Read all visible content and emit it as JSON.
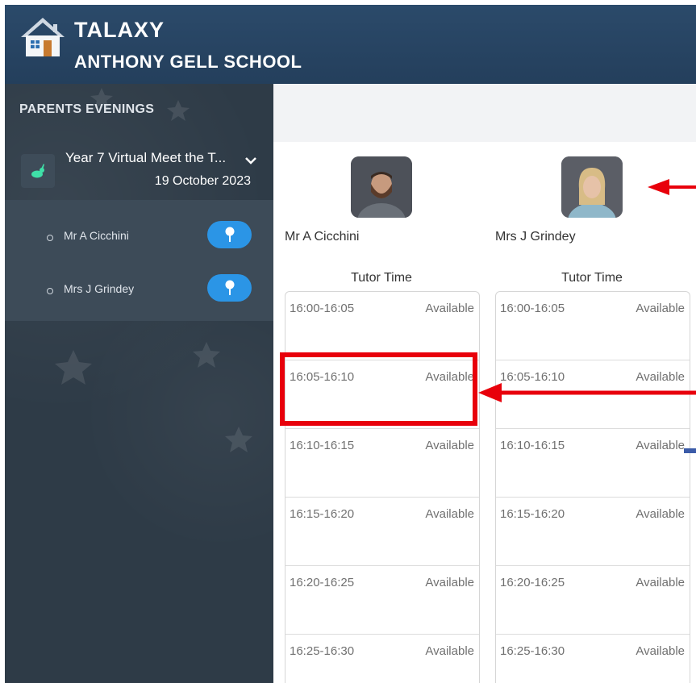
{
  "header": {
    "brand": "TALAXY",
    "school": "ANTHONY GELL SCHOOL"
  },
  "sidebar": {
    "title": "PARENTS EVENINGS",
    "event": {
      "name": "Year 7 Virtual Meet the T...",
      "date": "19 October 2023"
    },
    "teachers": [
      {
        "name": "Mr A Cicchini"
      },
      {
        "name": "Mrs J Grindey"
      }
    ]
  },
  "main": {
    "columns": [
      {
        "name": "Mr A Cicchini",
        "session": "Tutor Time",
        "slots": [
          {
            "time": "16:00-16:05",
            "status": "Available"
          },
          {
            "time": "16:05-16:10",
            "status": "Available"
          },
          {
            "time": "16:10-16:15",
            "status": "Available"
          },
          {
            "time": "16:15-16:20",
            "status": "Available"
          },
          {
            "time": "16:20-16:25",
            "status": "Available"
          },
          {
            "time": "16:25-16:30",
            "status": "Available"
          }
        ]
      },
      {
        "name": "Mrs J Grindey",
        "session": "Tutor Time",
        "slots": [
          {
            "time": "16:00-16:05",
            "status": "Available"
          },
          {
            "time": "16:05-16:10",
            "status": "Available"
          },
          {
            "time": "16:10-16:15",
            "status": "Available"
          },
          {
            "time": "16:15-16:20",
            "status": "Available"
          },
          {
            "time": "16:20-16:25",
            "status": "Available"
          },
          {
            "time": "16:25-16:30",
            "status": "Available"
          }
        ]
      }
    ]
  },
  "colors": {
    "header_bg": "#2b4a6a",
    "sidebar_bg": "#2e3b47",
    "pin_button": "#2b95e6",
    "annotation_red": "#e8000b"
  },
  "icons": {
    "logo": "house-icon",
    "event": "rabbit-icon",
    "expand": "chevron-down-icon",
    "pin": "pin-icon",
    "arrow": "arrow-left-icon"
  }
}
